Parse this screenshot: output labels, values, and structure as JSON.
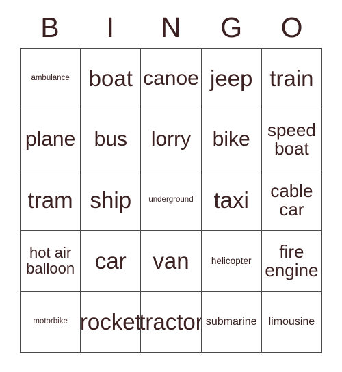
{
  "card": {
    "title": "BINGO",
    "theme": "transport",
    "text_color": "#3b2121",
    "border_color": "#4a4a4a",
    "background_color": "#ffffff",
    "columns": 5,
    "rows": 5
  },
  "header": {
    "letters": [
      "B",
      "I",
      "N",
      "G",
      "O"
    ]
  },
  "grid": {
    "cells": [
      {
        "label": "ambulance",
        "size": "sz-xxs"
      },
      {
        "label": "boat",
        "size": "sz-xl"
      },
      {
        "label": "canoe",
        "size": "sz-l"
      },
      {
        "label": "jeep",
        "size": "sz-xl"
      },
      {
        "label": "train",
        "size": "sz-xl"
      },
      {
        "label": "plane",
        "size": "sz-l"
      },
      {
        "label": "bus",
        "size": "sz-l"
      },
      {
        "label": "lorry",
        "size": "sz-l"
      },
      {
        "label": "bike",
        "size": "sz-l"
      },
      {
        "label": "speed boat",
        "size": "sz-ml"
      },
      {
        "label": "tram",
        "size": "sz-xl"
      },
      {
        "label": "ship",
        "size": "sz-xl"
      },
      {
        "label": "underground",
        "size": "sz-xxs"
      },
      {
        "label": "taxi",
        "size": "sz-xl"
      },
      {
        "label": "cable car",
        "size": "sz-ml"
      },
      {
        "label": "hot air balloon",
        "size": "sz-m"
      },
      {
        "label": "car",
        "size": "sz-xl"
      },
      {
        "label": "van",
        "size": "sz-xl"
      },
      {
        "label": "helicopter",
        "size": "sz-xs"
      },
      {
        "label": "fire engine",
        "size": "sz-ml"
      },
      {
        "label": "motorbike",
        "size": "sz-xxs"
      },
      {
        "label": "rocket",
        "size": "sz-xl"
      },
      {
        "label": "tractor",
        "size": "sz-xl"
      },
      {
        "label": "submarine",
        "size": "sz-s"
      },
      {
        "label": "limousine",
        "size": "sz-s"
      }
    ]
  }
}
